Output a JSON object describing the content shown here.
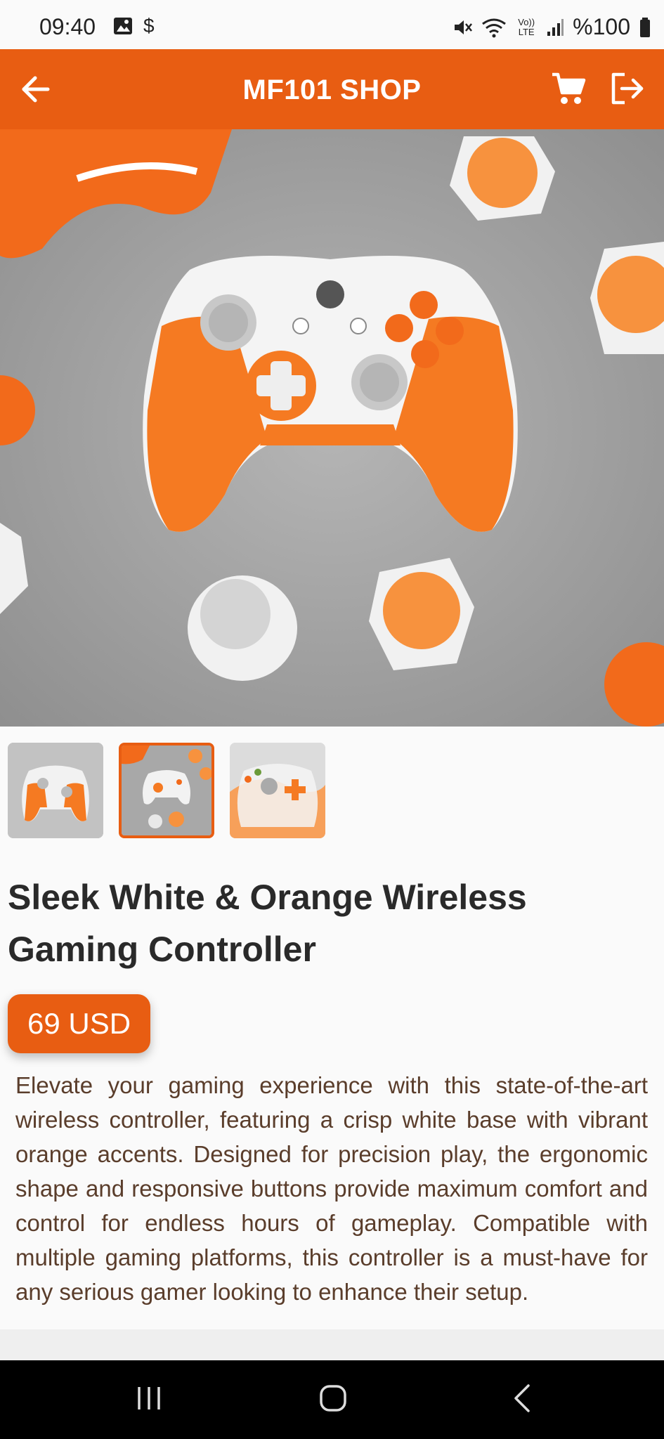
{
  "status_bar": {
    "time": "09:40",
    "battery": "%100",
    "left_icons": [
      "image-icon",
      "dollar-icon"
    ],
    "right_icons": [
      "mute-icon",
      "wifi-icon",
      "volte-icon",
      "signal-icon",
      "battery-icon"
    ],
    "volte_label": "Vo)) LTE",
    "dollar_glyph": "$"
  },
  "app_bar": {
    "title": "MF101 SHOP",
    "icons": [
      "arrow-left-icon",
      "cart-icon",
      "logout-icon"
    ]
  },
  "product": {
    "title": "Sleek White & Orange Wireless Gaming Controller",
    "price": "69 USD",
    "description": "Elevate your gaming experience with this state-of-the-art wireless controller, featuring a crisp white base with vibrant orange accents. Designed for precision play, the ergonomic shape and responsive buttons provide maximum comfort and control for endless hours of gameplay. Compatible with multiple gaming platforms, this controller is a must-have for any serious gamer looking to enhance their setup."
  },
  "thumbnails": {
    "count": 3,
    "selected_index": 1
  },
  "colors": {
    "accent": "#e85d12",
    "background": "#fafafa",
    "description_text": "#5a3d2b",
    "nav_bar": "#000000"
  },
  "nav_bar": {
    "icons": [
      "recent-apps-icon",
      "home-icon",
      "back-icon"
    ]
  }
}
